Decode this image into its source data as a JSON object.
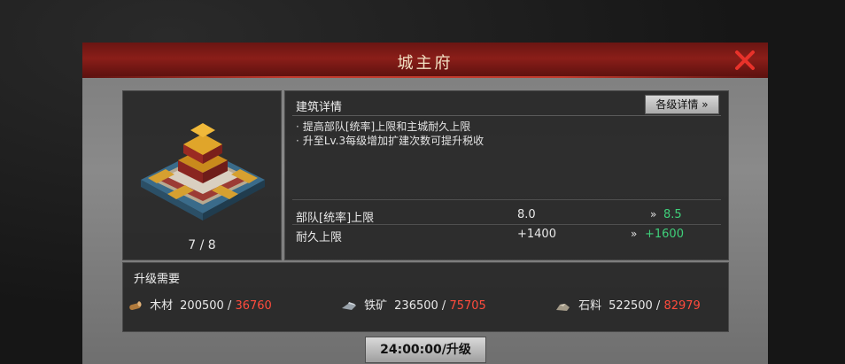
{
  "dialog": {
    "title": "城主府",
    "close_icon": "close-icon"
  },
  "building": {
    "level_text": "7 / 8",
    "image": "palace-building-icon"
  },
  "details": {
    "title": "建筑详情",
    "levels_button": "各级详情 »",
    "descriptions": [
      "提高部队[统率]上限和主城耐久上限",
      "升至Lv.3每级增加扩建次数可提升税收"
    ],
    "bullet": "·",
    "stats": [
      {
        "name": "部队[统率]上限",
        "current": "8.0",
        "arrow": "»",
        "next": "8.5"
      },
      {
        "name": "耐久上限",
        "current": "+1400",
        "arrow": "»",
        "next": "+1600"
      }
    ],
    "next_color": "#3fd07a"
  },
  "requirements": {
    "title": "升级需要",
    "resources": [
      {
        "icon": "wood-icon",
        "name": "木材",
        "have": "200500",
        "sep": " / ",
        "need": "36760"
      },
      {
        "icon": "iron-ore-icon",
        "name": "铁矿",
        "have": "236500",
        "sep": " / ",
        "need": "75705"
      },
      {
        "icon": "stone-icon",
        "name": "石料",
        "have": "522500",
        "sep": " / ",
        "need": "82979"
      }
    ],
    "need_color": "#ff4b3c"
  },
  "upgrade": {
    "label": "24:00:00/升级"
  }
}
